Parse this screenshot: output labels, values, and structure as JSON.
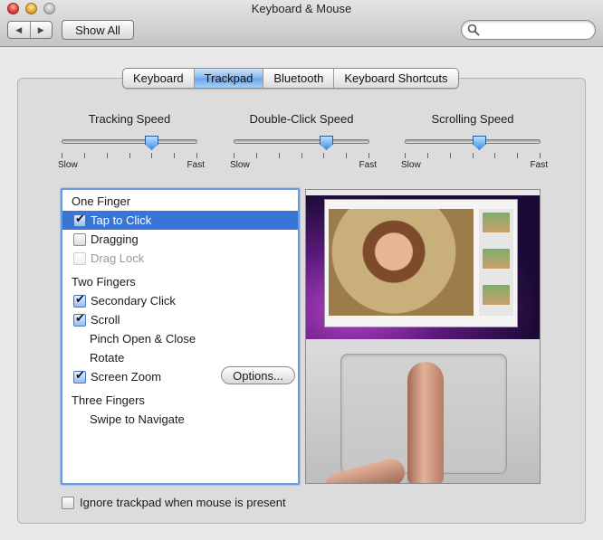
{
  "window": {
    "title": "Keyboard & Mouse"
  },
  "toolbar": {
    "back_glyph": "◀",
    "forward_glyph": "▶",
    "show_all_label": "Show All",
    "search_value": ""
  },
  "tabs": [
    {
      "label": "Keyboard",
      "selected": false
    },
    {
      "label": "Trackpad",
      "selected": true
    },
    {
      "label": "Bluetooth",
      "selected": false
    },
    {
      "label": "Keyboard Shortcuts",
      "selected": false
    }
  ],
  "sliders": [
    {
      "title": "Tracking Speed",
      "min_label": "Slow",
      "max_label": "Fast",
      "level": 0.66
    },
    {
      "title": "Double-Click Speed",
      "min_label": "Slow",
      "max_label": "Fast",
      "level": 0.68
    },
    {
      "title": "Scrolling Speed",
      "min_label": "Slow",
      "max_label": "Fast",
      "level": 0.55
    }
  ],
  "options": {
    "one_finger_title": "One Finger",
    "tap_to_click": {
      "label": "Tap to Click",
      "checked": true
    },
    "dragging": {
      "label": "Dragging",
      "checked": false
    },
    "drag_lock": {
      "label": "Drag Lock",
      "checked": false,
      "disabled": true
    },
    "two_fingers_title": "Two Fingers",
    "secondary_click": {
      "label": "Secondary Click",
      "checked": true
    },
    "scroll": {
      "label": "Scroll",
      "checked": true
    },
    "pinch": {
      "label": "Pinch Open & Close"
    },
    "rotate": {
      "label": "Rotate"
    },
    "screen_zoom": {
      "label": "Screen Zoom",
      "checked": true
    },
    "options_button": "Options...",
    "three_fingers_title": "Three Fingers",
    "swipe": {
      "label": "Swipe to Navigate"
    }
  },
  "ignore_trackpad": {
    "label": "Ignore trackpad when mouse is present",
    "checked": false
  },
  "colors": {
    "selection": "#3875d7",
    "focus_ring": "#6b9ad8"
  }
}
